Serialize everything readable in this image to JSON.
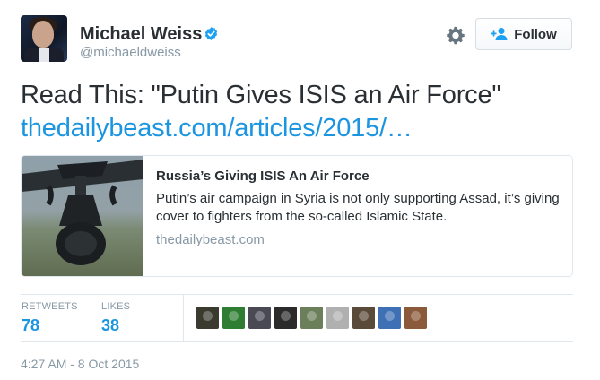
{
  "author": {
    "name": "Michael Weiss",
    "handle": "@michaeldweiss",
    "verified": true,
    "icons": {
      "avatar": "profile-photo",
      "verified": "verified-badge-icon"
    }
  },
  "actions": {
    "settings_icon": "gear-icon",
    "follow_label": "Follow",
    "follow_icon": "add-person-icon"
  },
  "tweet": {
    "text": "Read This: \"Putin Gives ISIS an Air Force\"",
    "link_text": "thedailybeast.com/articles/2015/…"
  },
  "card": {
    "title": "Russia’s Giving ISIS An Air Force",
    "description": "Putin’s air campaign in Syria is not only supporting Assad, it’s giving cover to fighters from the so-called Islamic State.",
    "domain": "thedailybeast.com",
    "image_icon": "bomb-drop-photo"
  },
  "stats": {
    "retweets_label": "RETWEETS",
    "retweets_count": "78",
    "likes_label": "LIKES",
    "likes_count": "38"
  },
  "likers": [
    {
      "name": "liker-avatar-1",
      "color": "#3a3a2e"
    },
    {
      "name": "liker-avatar-2",
      "color": "#2e7d32"
    },
    {
      "name": "liker-avatar-3",
      "color": "#4a4a55"
    },
    {
      "name": "liker-avatar-4",
      "color": "#2b2b2b"
    },
    {
      "name": "liker-avatar-5",
      "color": "#6b7f5a"
    },
    {
      "name": "liker-avatar-6",
      "color": "#b0b0b0"
    },
    {
      "name": "liker-avatar-7",
      "color": "#5a4a3a"
    },
    {
      "name": "liker-avatar-8",
      "color": "#3f6fb5"
    },
    {
      "name": "liker-avatar-9",
      "color": "#8a5a3a"
    }
  ],
  "timestamp": "4:27 AM - 8 Oct 2015",
  "colors": {
    "link": "#1b95e0",
    "text": "#292f33",
    "muted": "#8899a6",
    "border": "#e1e8ed",
    "verified": "#1da1f2"
  }
}
